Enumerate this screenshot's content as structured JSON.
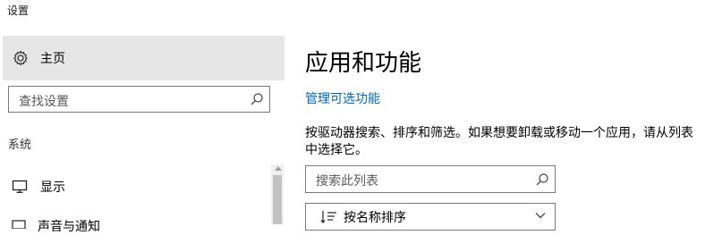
{
  "window": {
    "title": "设置"
  },
  "sidebar": {
    "home_label": "主页",
    "search_placeholder": "查找设置",
    "section_label": "系统",
    "items": [
      {
        "label": "显示",
        "icon": "monitor-icon"
      },
      {
        "label": "声音与通知",
        "icon": "notifications-icon"
      }
    ]
  },
  "main": {
    "title": "应用和功能",
    "manage_link": "管理可选功能",
    "description": "按驱动器搜索、排序和筛选。如果想要卸载或移动一个应用，请从列表中选择它。",
    "search_placeholder": "搜索此列表",
    "sort_label": "按名称排序"
  },
  "colors": {
    "accent": "#0067c0",
    "selected_bg": "#e6e6e6"
  }
}
